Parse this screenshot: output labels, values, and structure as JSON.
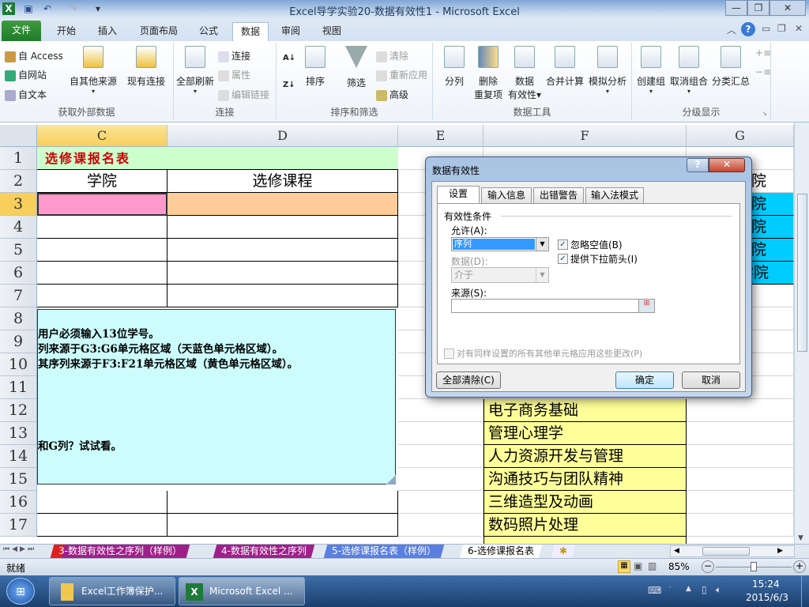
{
  "window": {
    "title": "Excel导学实验20-数据有效性1 - Microsoft Excel"
  },
  "ribbon_tabs": [
    "文件",
    "开始",
    "插入",
    "页面布局",
    "公式",
    "数据",
    "审阅",
    "视图"
  ],
  "ribbon": {
    "get_external": {
      "label": "获取外部数据",
      "access": "自 Access",
      "web": "自网站",
      "text": "自文本",
      "other": "自其他来源",
      "existing": "现有连接"
    },
    "connections": {
      "label": "连接",
      "refresh_all": "全部刷新",
      "connections": "连接",
      "properties": "属性",
      "edit_links": "编辑链接"
    },
    "sort_filter": {
      "label": "排序和筛选",
      "sort": "排序",
      "filter": "筛选",
      "clear": "清除",
      "reapply": "重新应用",
      "advanced": "高级"
    },
    "data_tools": {
      "label": "数据工具",
      "text_to_columns": "分列",
      "remove_dup_1": "删除",
      "remove_dup_2": "重复项",
      "validation_1": "数据",
      "validation_2": "有效性",
      "consolidate": "合并计算",
      "what_if": "模拟分析"
    },
    "outline": {
      "label": "分级显示",
      "group": "创建组",
      "ungroup": "取消组合",
      "subtotal": "分类汇总"
    }
  },
  "columns": [
    "C",
    "D",
    "E",
    "F",
    "G"
  ],
  "rows": [
    "1",
    "2",
    "3",
    "4",
    "5",
    "6",
    "7",
    "8",
    "9",
    "10",
    "11",
    "12",
    "13",
    "14",
    "15",
    "16",
    "17"
  ],
  "sheet": {
    "title": "选修课报名表",
    "header_college": "学院",
    "header_course": "选修课程",
    "g_partial": [
      "院",
      "院",
      "院",
      "院",
      "学院"
    ],
    "courses": [
      "电子商务基础",
      "管理心理学",
      "人力资源开发与管理",
      "沟通技巧与团队精神",
      "三维造型及动画",
      "数码照片处理"
    ]
  },
  "note": {
    "lines": [
      "用户必须输入13位学号。",
      "列来源于G3:G6单元格区域（天蓝色单元格区域）。",
      "其序列来源于F3:F21单元格区域（黄色单元格区域）。",
      "和G列？试试看。"
    ]
  },
  "dialog": {
    "title": "数据有效性",
    "tabs": [
      "设置",
      "输入信息",
      "出错警告",
      "输入法模式"
    ],
    "section": "有效性条件",
    "allow_label": "允许(A):",
    "allow_value": "序列",
    "data_label": "数据(D):",
    "data_value": "介于",
    "source_label": "来源(S):",
    "source_value": "",
    "ignore_blank": {
      "label": "忽略空值(B)",
      "checked": true
    },
    "dropdown": {
      "label": "提供下拉箭头(I)",
      "checked": true
    },
    "apply_all": {
      "label": "对有同样设置的所有其他单元格应用这些更改(P)",
      "checked": false
    },
    "clear_all": "全部清除(C)",
    "ok": "确定",
    "cancel": "取消"
  },
  "sheet_tabs": [
    "3-数据有效性之序列（样例）",
    "4-数据有效性之序列",
    "5-选修课报名表（样例）",
    "6-选修课报名表"
  ],
  "status": {
    "ready": "就绪",
    "zoom": "85%",
    "zoom_fraction": 0.5
  },
  "taskbar": {
    "items": [
      "Excel工作簿保护...",
      "Microsoft Excel ..."
    ],
    "time": "15:24",
    "date": "2015/6/3"
  }
}
